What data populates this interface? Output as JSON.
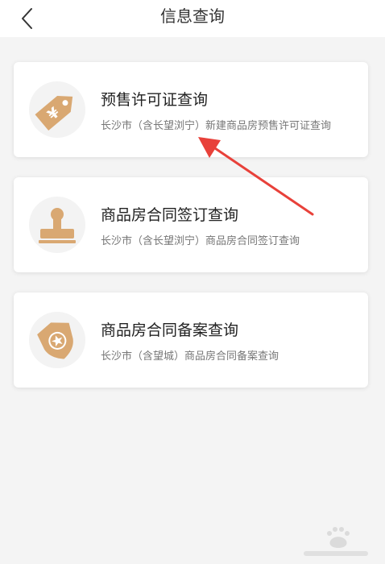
{
  "header": {
    "title": "信息查询"
  },
  "cards": [
    {
      "title": "预售许可证查询",
      "description": "长沙市（含长望浏宁）新建商品房预售许可证查询",
      "icon": "price-tag-icon"
    },
    {
      "title": "商品房合同签订查询",
      "description": "长沙市（含长望浏宁）商品房合同签订查询",
      "icon": "stamp-icon"
    },
    {
      "title": "商品房合同备案查询",
      "description": "长沙市（含望城）商品房合同备案查询",
      "icon": "shield-star-icon"
    }
  ],
  "colors": {
    "icon_tan": "#d9a872",
    "annotation_arrow": "#e8413a"
  }
}
